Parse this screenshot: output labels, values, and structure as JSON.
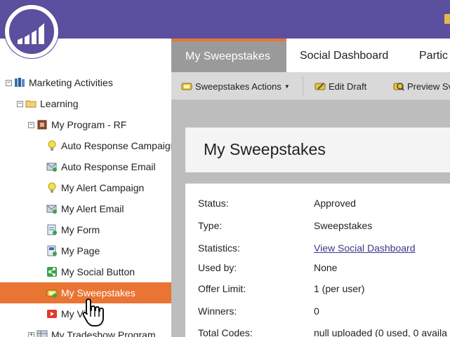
{
  "header": {
    "brand_color": "#5b4f9f",
    "logo_icon": "marketo-logo"
  },
  "tree": {
    "selected_color": "#ea7433",
    "items": [
      {
        "label": "Marketing Activities",
        "icon": "marketing-activities-icon",
        "level": 0,
        "expander": "−"
      },
      {
        "label": "Learning",
        "icon": "folder-icon",
        "level": 1,
        "expander": "−"
      },
      {
        "label": "My Program - RF",
        "icon": "program-icon",
        "level": 2,
        "expander": "−"
      },
      {
        "label": "Auto Response Campaign",
        "icon": "campaign-bulb-icon",
        "level": 3,
        "expander": ""
      },
      {
        "label": "Auto Response Email",
        "icon": "email-icon",
        "level": 3,
        "expander": ""
      },
      {
        "label": "My Alert Campaign",
        "icon": "campaign-bulb-icon",
        "level": 3,
        "expander": ""
      },
      {
        "label": "My Alert Email",
        "icon": "email-icon",
        "level": 3,
        "expander": ""
      },
      {
        "label": "My Form",
        "icon": "form-icon",
        "level": 3,
        "expander": ""
      },
      {
        "label": "My Page",
        "icon": "landing-page-icon",
        "level": 3,
        "expander": ""
      },
      {
        "label": "My Social Button",
        "icon": "social-button-icon",
        "level": 3,
        "expander": ""
      },
      {
        "label": "My Sweepstakes",
        "icon": "sweepstakes-icon",
        "level": 3,
        "expander": "",
        "selected": true
      },
      {
        "label": "My Vi",
        "icon": "video-icon",
        "level": 3,
        "expander": ""
      },
      {
        "label": "My Tradeshow Program",
        "icon": "tradeshow-program-icon",
        "level": 2,
        "expander": "+"
      }
    ]
  },
  "tabs": [
    {
      "label": "My Sweepstakes",
      "active": true
    },
    {
      "label": "Social Dashboard",
      "active": false
    },
    {
      "label": "Partic",
      "active": false
    }
  ],
  "toolbar": {
    "actions_label": "Sweepstakes Actions",
    "edit_draft_label": "Edit Draft",
    "preview_label": "Preview Sv"
  },
  "main": {
    "title": "My Sweepstakes",
    "details": [
      {
        "label": "Status:",
        "value": "Approved",
        "link": false
      },
      {
        "label": "Type:",
        "value": "Sweepstakes",
        "link": false
      },
      {
        "label": "Statistics:",
        "value": "View Social Dashboard",
        "link": true
      },
      {
        "label": "Used by:",
        "value": "None",
        "link": false
      },
      {
        "label": "Offer Limit:",
        "value": "1 (per user)",
        "link": false
      },
      {
        "label": "Winners:",
        "value": "0",
        "link": false
      },
      {
        "label": "Total Codes:",
        "value": "null uploaded (0 used, 0 availa",
        "link": false
      }
    ]
  }
}
